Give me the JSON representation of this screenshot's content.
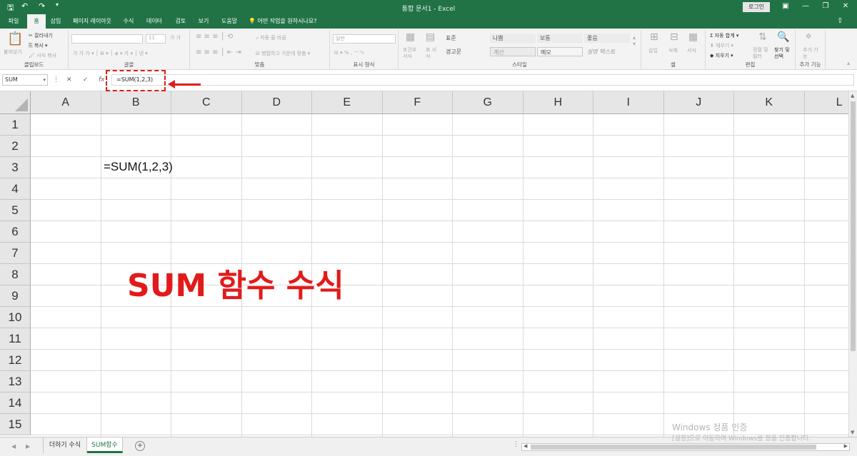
{
  "titlebar": {
    "title": "통합 문서1  -  Excel",
    "login": "로그인",
    "save_icon": "save-icon",
    "undo_icon": "undo-icon",
    "redo_icon": "redo-icon"
  },
  "tabs": [
    {
      "label": "파일",
      "active": false
    },
    {
      "label": "홈",
      "active": true
    },
    {
      "label": "삽입",
      "active": false
    },
    {
      "label": "페이지 레이아웃",
      "active": false
    },
    {
      "label": "수식",
      "active": false
    },
    {
      "label": "데이터",
      "active": false
    },
    {
      "label": "검토",
      "active": false
    },
    {
      "label": "보기",
      "active": false
    },
    {
      "label": "도움말",
      "active": false
    }
  ],
  "tell_me": "어떤 작업을 원하시나요?",
  "ribbon": {
    "clipboard": {
      "label": "클립보드",
      "paste": "붙여넣기",
      "cut": "잘라내기",
      "copy": "복사",
      "format_painter": "서식 복사"
    },
    "font": {
      "label": "글꼴",
      "size": "11"
    },
    "alignment": {
      "label": "맞춤",
      "wrap": "자동 줄 바꿈",
      "merge": "병합하고 가운데 맞춤"
    },
    "number": {
      "label": "표시 형식",
      "format": "일반"
    },
    "styles": {
      "label": "스타일",
      "conditional": "조건부 서식",
      "table": "표 서식",
      "cells": [
        {
          "name": "표준",
          "bg": "#ffffff"
        },
        {
          "name": "나쁨",
          "bg": "#ffc7ce"
        },
        {
          "name": "보통",
          "bg": "#ffeb9c"
        },
        {
          "name": "좋음",
          "bg": "#c6efce"
        },
        {
          "name": "경고문",
          "bg": "#ffffff"
        },
        {
          "name": "계산",
          "bg": "#f2f2f2"
        },
        {
          "name": "메모",
          "bg": "#ffffcc"
        },
        {
          "name": "설명 텍스트",
          "bg": "#ffffff"
        }
      ]
    },
    "cells": {
      "label": "셀",
      "insert": "삽입",
      "delete": "삭제",
      "format": "서식"
    },
    "editing": {
      "label": "편집",
      "autosum": "자동 합계",
      "fill": "채우기",
      "clear": "지우기",
      "sort": "정렬 및 필터",
      "find": "찾기 및 선택"
    },
    "addins": {
      "label": "추가 기능",
      "btn": "추가 기능"
    }
  },
  "formula_bar": {
    "name_box": "SUM",
    "cancel": "✕",
    "enter": "✓",
    "fx": "fx",
    "formula": "=SUM(1,2,3)"
  },
  "grid": {
    "columns": [
      "A",
      "B",
      "C",
      "D",
      "E",
      "F",
      "G",
      "H",
      "I",
      "J",
      "K",
      "L"
    ],
    "rows": [
      "1",
      "2",
      "3",
      "4",
      "5",
      "6",
      "7",
      "8",
      "9",
      "10",
      "11",
      "12",
      "13",
      "14",
      "15"
    ],
    "cell_b3": "=SUM(1,2,3)"
  },
  "annotation": "SUM 함수 수식",
  "watermark": {
    "line1": "Windows 정품 인증",
    "line2": "[설정]으로 이동하여 Windows를 정품 인증합니다."
  },
  "sheets": [
    {
      "label": "더하기 수식",
      "active": false
    },
    {
      "label": "SUM함수",
      "active": true
    }
  ],
  "colors": {
    "excel_green": "#217346",
    "annotation_red": "#e11b1b"
  }
}
